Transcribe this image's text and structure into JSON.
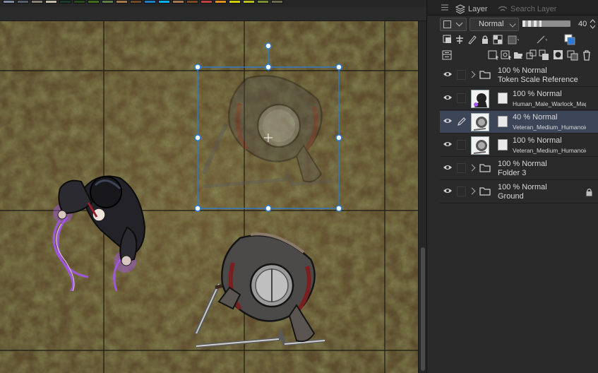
{
  "palette": {
    "swatch_colors": [
      "#7d8aa0",
      "#565e6a",
      "#8a8276",
      "#c2bdaa",
      "#1b3a2a",
      "#294a1a",
      "#3f6d1a",
      "#5f7d4a",
      "#a37d48",
      "#6e4a2a",
      "#1d7fc0",
      "#00b0e8",
      "#a47850",
      "#7a4a20",
      "#c04040",
      "#e09020",
      "#d0d000",
      "#b8c020",
      "#7a9030",
      "#6a6a4a"
    ]
  },
  "panel": {
    "tabs": [
      {
        "label": "Layer",
        "icon": "layers-icon"
      },
      {
        "label": "Search Layer",
        "icon": "search-layer-icon"
      }
    ],
    "blend_mode": "Normal",
    "opacity": 40,
    "opacity_display": "40"
  },
  "layers": [
    {
      "kind": "folder",
      "line1": "100 % Normal",
      "line2": "Token Scale Reference",
      "visible": true,
      "locked": false,
      "selected": false
    },
    {
      "kind": "image",
      "line1": "100 % Normal",
      "line2": "Human_Male_Warlock_Mag",
      "visible": true,
      "locked": false,
      "selected": false
    },
    {
      "kind": "image",
      "line1": "40 % Normal",
      "line2": "Veteran_Medium_Humanoid",
      "visible": true,
      "locked": false,
      "selected": true
    },
    {
      "kind": "image",
      "line1": "100 % Normal",
      "line2": "Veteran_Medium_Humanoid",
      "visible": true,
      "locked": false,
      "selected": false
    },
    {
      "kind": "folder",
      "line1": "100 % Normal",
      "line2": "Folder 3",
      "visible": true,
      "locked": false,
      "selected": false
    },
    {
      "kind": "folder",
      "line1": "100 % Normal",
      "line2": "Ground",
      "visible": true,
      "locked": true,
      "selected": false
    }
  ],
  "colors": {
    "selection": "#2b7bd6",
    "selected_row": "#3d4659",
    "grid_line": "#1b1b12",
    "magic_glow": "#a855f7"
  }
}
